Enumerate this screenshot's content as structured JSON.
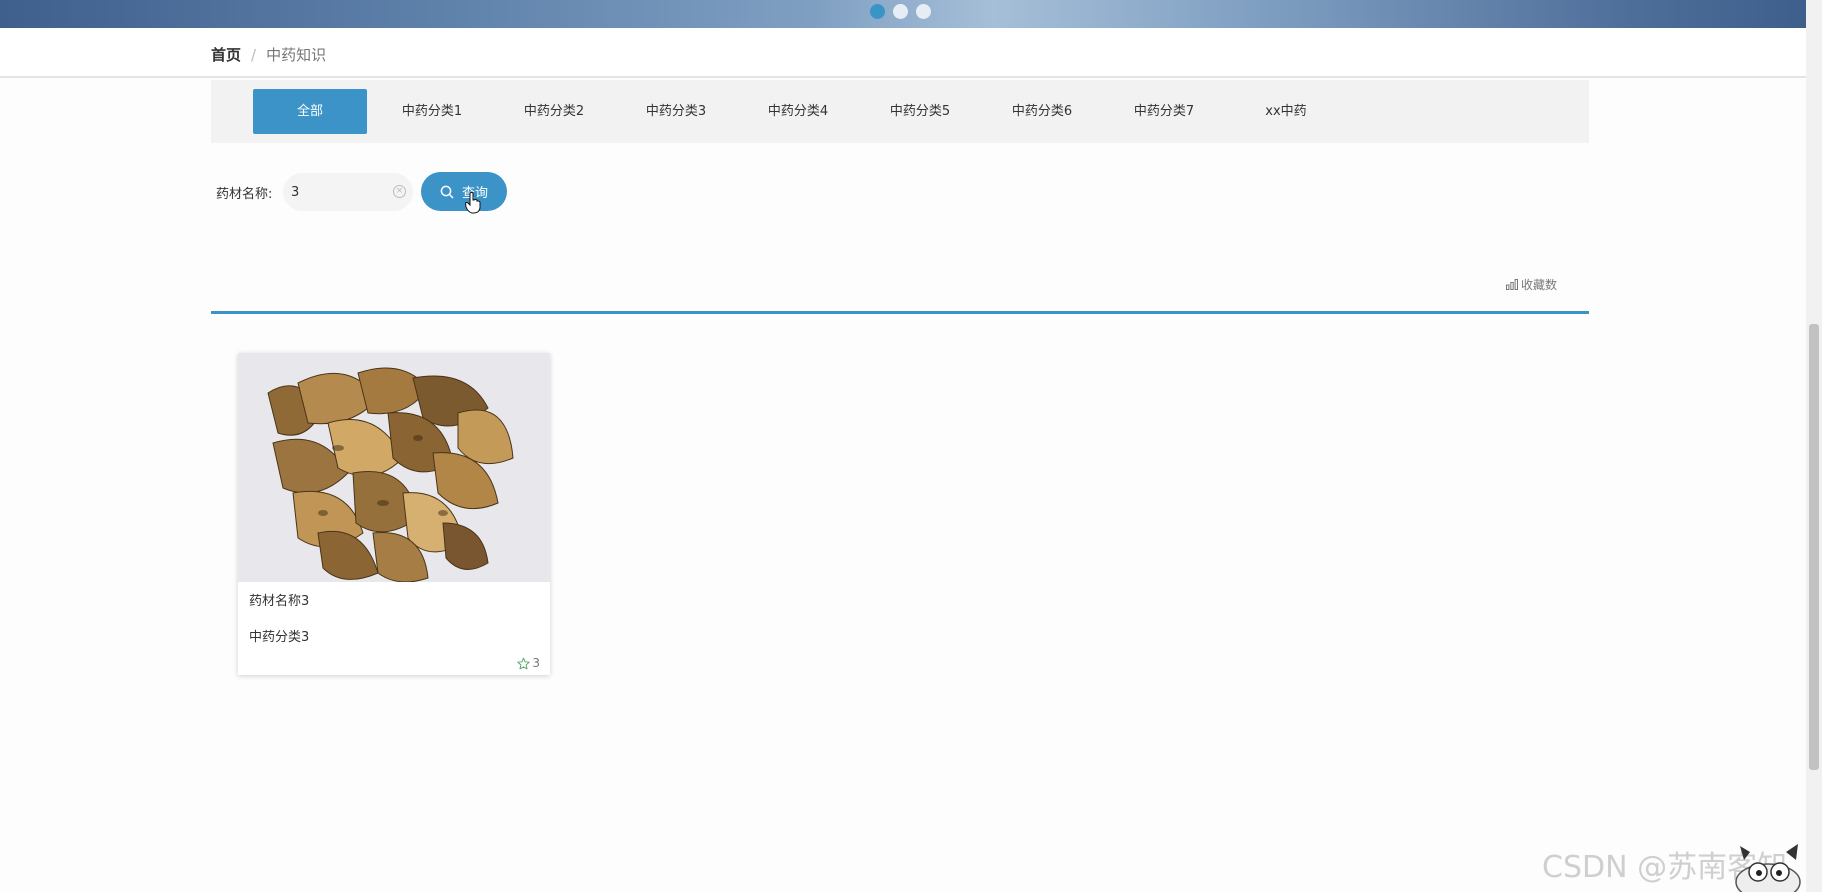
{
  "banner": {
    "slides": 3,
    "active_slide": 1
  },
  "breadcrumb": {
    "home": "首页",
    "separator": "/",
    "current": "中药知识"
  },
  "categories": [
    "全部",
    "中药分类1",
    "中药分类2",
    "中药分类3",
    "中药分类4",
    "中药分类5",
    "中药分类6",
    "中药分类7",
    "xx中药"
  ],
  "search": {
    "label": "药材名称:",
    "value": "3",
    "button_label": "查询"
  },
  "sort": {
    "label": "收藏数"
  },
  "items": [
    {
      "name": "药材名称3",
      "category": "中药分类3",
      "favorites": "3"
    }
  ],
  "watermark": "CSDN @苏南客知",
  "colors": {
    "accent": "#3b93c7",
    "category_bg": "#f2f2f2"
  }
}
